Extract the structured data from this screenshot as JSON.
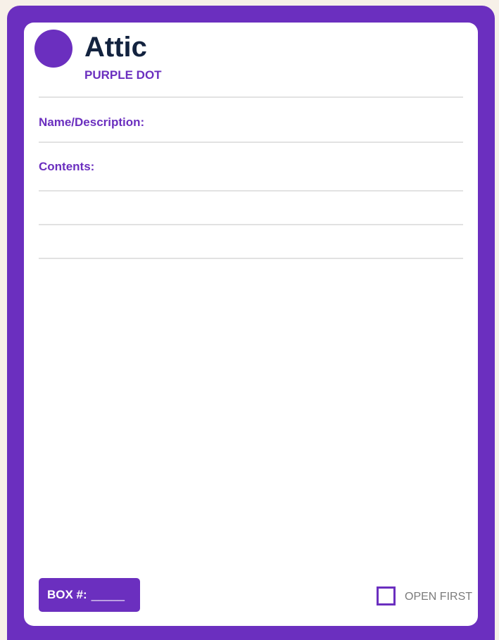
{
  "label": {
    "room": "Attic",
    "color_name": "PURPLE DOT",
    "fields": {
      "name_description": "Name/Description:",
      "contents": "Contents:"
    },
    "box_number": {
      "prefix": "BOX #:",
      "blank": "_____"
    },
    "open_first": {
      "label": "OPEN FIRST",
      "checked": false
    },
    "colors": {
      "accent": "#6b2fbf",
      "title": "#13233f",
      "background": "#f7f0e8",
      "rule": "#e2e2e2"
    },
    "icons": {
      "dot": "purple-dot-icon",
      "checkbox": "checkbox-icon"
    }
  }
}
